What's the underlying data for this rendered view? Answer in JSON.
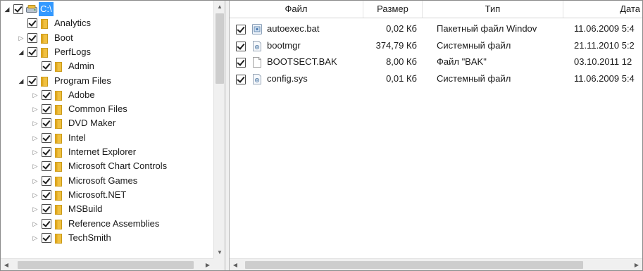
{
  "tree": {
    "root": {
      "label": "C:\\",
      "checked": true,
      "expanded": true
    },
    "items": [
      {
        "label": "Analytics",
        "level": 1,
        "expander": "none",
        "checked": true
      },
      {
        "label": "Boot",
        "level": 1,
        "expander": "collapsed",
        "checked": true
      },
      {
        "label": "PerfLogs",
        "level": 1,
        "expander": "expanded",
        "checked": true
      },
      {
        "label": "Admin",
        "level": 2,
        "expander": "none",
        "checked": true
      },
      {
        "label": "Program Files",
        "level": 1,
        "expander": "expanded",
        "checked": true
      },
      {
        "label": "Adobe",
        "level": 2,
        "expander": "collapsed",
        "checked": true
      },
      {
        "label": "Common Files",
        "level": 2,
        "expander": "collapsed",
        "checked": true
      },
      {
        "label": "DVD Maker",
        "level": 2,
        "expander": "collapsed",
        "checked": true
      },
      {
        "label": "Intel",
        "level": 2,
        "expander": "collapsed",
        "checked": true
      },
      {
        "label": "Internet Explorer",
        "level": 2,
        "expander": "collapsed",
        "checked": true
      },
      {
        "label": "Microsoft Chart Controls",
        "level": 2,
        "expander": "collapsed",
        "checked": true
      },
      {
        "label": "Microsoft Games",
        "level": 2,
        "expander": "collapsed",
        "checked": true
      },
      {
        "label": "Microsoft.NET",
        "level": 2,
        "expander": "collapsed",
        "checked": true
      },
      {
        "label": "MSBuild",
        "level": 2,
        "expander": "collapsed",
        "checked": true
      },
      {
        "label": "Reference Assemblies",
        "level": 2,
        "expander": "collapsed",
        "checked": true
      },
      {
        "label": "TechSmith",
        "level": 2,
        "expander": "collapsed",
        "checked": true
      }
    ]
  },
  "file_list": {
    "columns": [
      "Файл",
      "Размер",
      "Тип",
      "Дата"
    ],
    "rows": [
      {
        "name": "autoexec.bat",
        "size": "0,02 Кб",
        "type": "Пакетный файл Windov",
        "date": "11.06.2009 5:4",
        "icon": "batch-file-icon",
        "checked": true
      },
      {
        "name": "bootmgr",
        "size": "374,79 Кб",
        "type": "Системный файл",
        "date": "21.11.2010 5:2",
        "icon": "system-file-icon",
        "checked": true
      },
      {
        "name": "BOOTSECT.BAK",
        "size": "8,00 Кб",
        "type": "Файл \"BAK\"",
        "date": "03.10.2011 12",
        "icon": "blank-file-icon",
        "checked": true
      },
      {
        "name": "config.sys",
        "size": "0,01 Кб",
        "type": "Системный файл",
        "date": "11.06.2009 5:4",
        "icon": "system-file-icon",
        "checked": true
      }
    ]
  },
  "colors": {
    "selection": "#3399ff",
    "folder": "#f0c040",
    "scrollbar_track": "#f0f0f0",
    "scrollbar_thumb": "#cdcdcd"
  }
}
